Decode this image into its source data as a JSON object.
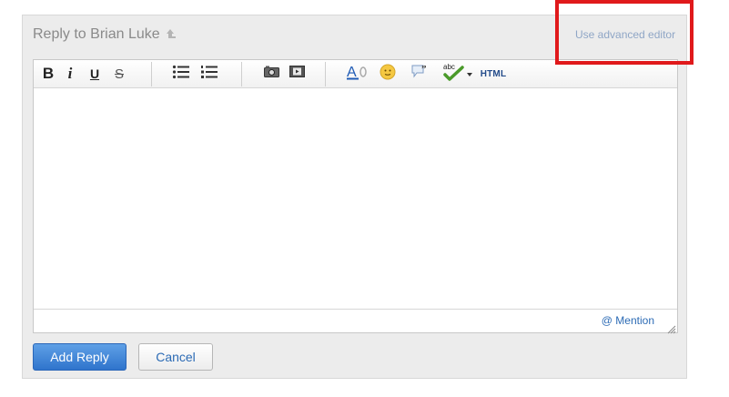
{
  "reply": {
    "title": "Reply to Brian Luke",
    "advanced_editor_label": "Use advanced editor"
  },
  "toolbar": {
    "bold_label": "B",
    "italic_label": "i",
    "underline_label": "U",
    "strike_label": "S",
    "html_label": "HTML",
    "icons": [
      "bold",
      "italic",
      "underline",
      "strikethrough",
      "bullet-list-icon",
      "numbered-list-icon",
      "insert-image-icon",
      "insert-video-icon",
      "text-style-icon",
      "emoticon-icon",
      "quote-icon",
      "spellcheck-icon",
      "chevron-down-icon",
      "html-source"
    ]
  },
  "editor": {
    "body_text": "",
    "mention_label": "@ Mention"
  },
  "actions": {
    "add_reply_label": "Add Reply",
    "cancel_label": "Cancel"
  },
  "colors": {
    "highlight": "#e0191b",
    "primary_button": "#2f74cc",
    "link": "#2c6bb5"
  }
}
